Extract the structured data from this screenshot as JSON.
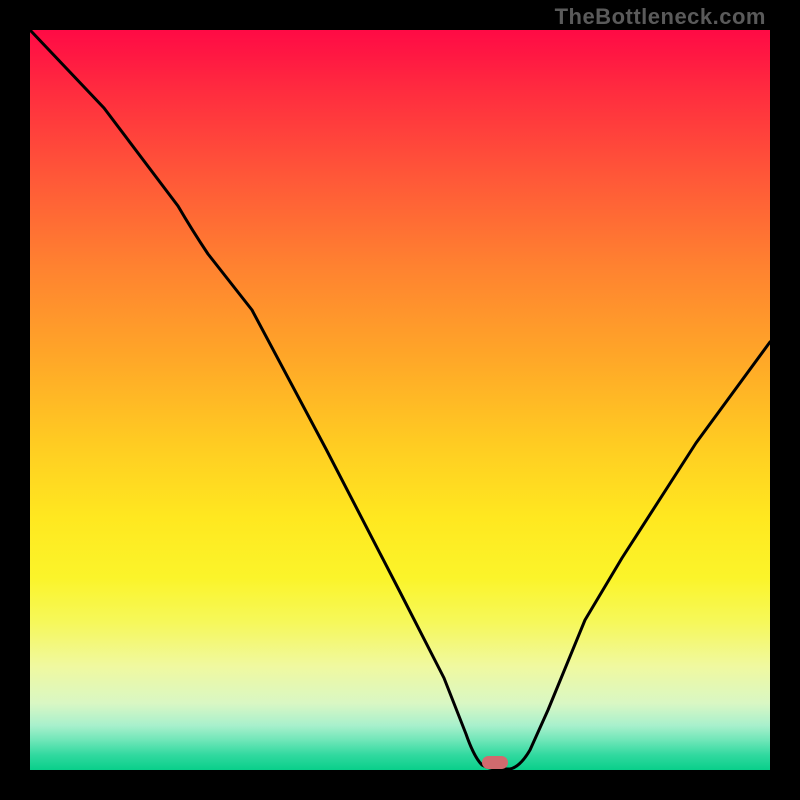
{
  "watermark": "TheBottleneck.com",
  "chart_data": {
    "type": "line",
    "title": "",
    "xlabel": "",
    "ylabel": "",
    "xlim": [
      0,
      100
    ],
    "ylim": [
      0,
      100
    ],
    "x": [
      0,
      10,
      20,
      30,
      40,
      50,
      56,
      60,
      62,
      64,
      70,
      80,
      90,
      100
    ],
    "values": [
      100,
      89,
      79,
      68,
      53,
      33,
      12,
      0.5,
      0,
      0.5,
      12,
      30,
      45,
      58
    ],
    "marker": {
      "x": 62.5,
      "y": 0
    },
    "grid": false,
    "legend": false
  }
}
